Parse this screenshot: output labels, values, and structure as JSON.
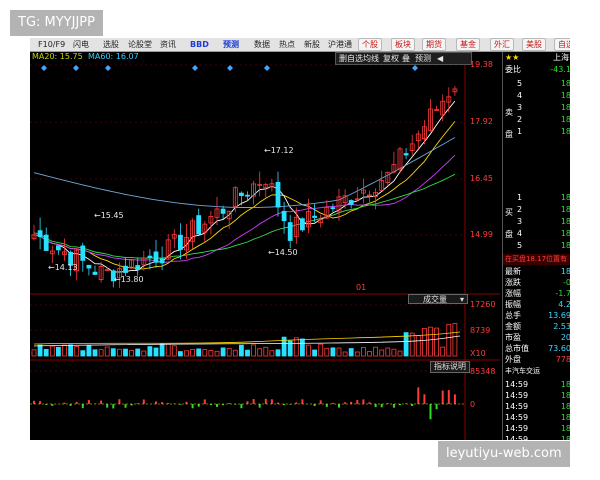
{
  "menu": {
    "items": [
      {
        "label": "F10/F9",
        "style": "normal"
      },
      {
        "label": "闪电",
        "style": "normal"
      },
      {
        "label": "选股",
        "style": "normal"
      },
      {
        "label": "论股堂",
        "style": "normal"
      },
      {
        "label": "资讯",
        "style": "normal"
      },
      {
        "label": "BBD",
        "style": "blue"
      },
      {
        "label": "预测",
        "style": "blue"
      },
      {
        "label": "数据",
        "style": "normal"
      },
      {
        "label": "热点",
        "style": "normal"
      },
      {
        "label": "新股",
        "style": "normal"
      },
      {
        "label": "沪港通",
        "style": "normal"
      },
      {
        "label": "个股",
        "style": "tab"
      },
      {
        "label": "板块",
        "style": "tab"
      },
      {
        "label": "期货",
        "style": "tab"
      },
      {
        "label": "基金",
        "style": "tab"
      },
      {
        "label": "外汇",
        "style": "tab"
      },
      {
        "label": "美股",
        "style": "tab"
      },
      {
        "label": "自选",
        "style": "tab"
      }
    ]
  },
  "ma_legend": {
    "ma5": "MA20: 15.75",
    "ma60": "MA60: 16.07"
  },
  "toolbar": {
    "items": [
      "删自选",
      "均线",
      "复权",
      "叠",
      "预测",
      "◀"
    ]
  },
  "price_axis": {
    "ticks": [
      "19.38",
      "17.92",
      "16.45",
      "14.99"
    ]
  },
  "price_annotations": {
    "high": "17.12",
    "a": "15.45",
    "b": "14.50",
    "c": "14.13",
    "d": "13.80"
  },
  "volume": {
    "selector_label": "成交量",
    "axis": [
      "17260",
      "8739",
      "X10"
    ]
  },
  "indicator": {
    "label": "指标说明",
    "axis": [
      "85348",
      "0"
    ]
  },
  "right_panel": {
    "header": "上海",
    "wei_bi_label": "委比",
    "wei_bi_value": "-43.1",
    "sell_title": "卖盘",
    "sell_rows": [
      {
        "level": "5",
        "value": "18"
      },
      {
        "level": "4",
        "value": "18"
      },
      {
        "level": "3",
        "value": "18"
      },
      {
        "level": "2",
        "value": "18"
      },
      {
        "level": "1",
        "value": "18"
      }
    ],
    "buy_title": "买盘",
    "buy_rows": [
      {
        "level": "1",
        "value": "18"
      },
      {
        "level": "2",
        "value": "18"
      },
      {
        "level": "3",
        "value": "18"
      },
      {
        "level": "4",
        "value": "18"
      },
      {
        "level": "5",
        "value": "18"
      }
    ],
    "notice": "在买盘18.17位置有",
    "stats": [
      {
        "label": "最新",
        "value": "18"
      },
      {
        "label": "涨跌",
        "value": "-0"
      },
      {
        "label": "涨幅",
        "value": "-1.7"
      },
      {
        "label": "振幅",
        "value": "4.2"
      },
      {
        "label": "总手",
        "value": "13.69"
      },
      {
        "label": "金额",
        "value": "2.53"
      },
      {
        "label": "市盈",
        "value": "20"
      },
      {
        "label": "总市值",
        "value": "73.60"
      },
      {
        "label": "外盘",
        "value": "778"
      }
    ],
    "ticker_title": "丰汽车交运",
    "ticks": [
      "14:59",
      "14:59",
      "14:59",
      "14:59",
      "14:59",
      "14:59",
      "14:59",
      "14:59",
      "14:59",
      "14:59"
    ],
    "tick_value": "18"
  },
  "colors": {
    "up": "#ff3b3b",
    "down": "#28e0ff",
    "grid": "#8b0000"
  },
  "watermarks": {
    "top_left": "TG: MYYJJPP",
    "bottom_right": "leyutiyu-web.com"
  }
}
